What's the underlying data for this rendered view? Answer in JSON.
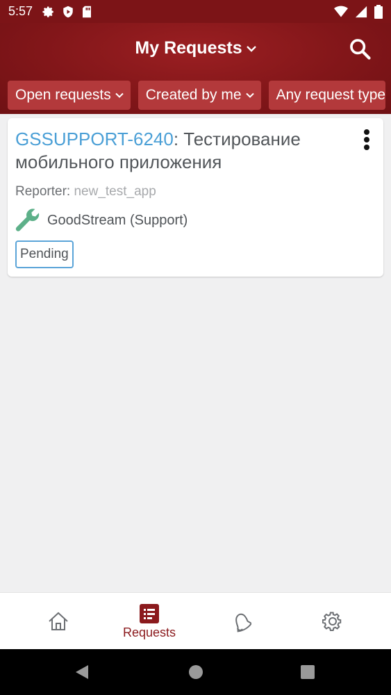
{
  "status_bar": {
    "time": "5:57",
    "icons": [
      "gear-icon",
      "shield-play-icon",
      "sd-card-icon",
      "wifi-icon",
      "signal-icon",
      "battery-icon"
    ]
  },
  "app_bar": {
    "title": "My Requests",
    "search_icon": "search-icon",
    "filters": [
      "Open requests",
      "Created by me",
      "Any request type"
    ]
  },
  "requests": [
    {
      "key": "GSSUPPORT-6240",
      "summary": ": Тестирование мобильного приложения",
      "reporter_label": "Reporter:",
      "reporter": "new_test_app",
      "project": "GoodStream (Support)",
      "status": "Pending"
    }
  ],
  "bottom_nav": {
    "items": [
      {
        "icon": "home-icon",
        "label": ""
      },
      {
        "icon": "requests-icon",
        "label": "Requests",
        "active": true
      },
      {
        "icon": "bell-icon",
        "label": ""
      },
      {
        "icon": "settings-icon",
        "label": ""
      }
    ]
  },
  "colors": {
    "app_bar": "#821619",
    "chip": "#b3393b",
    "link": "#4a9fd6",
    "active_nav": "#8b1a1d",
    "status_border": "#5aa4d8"
  }
}
